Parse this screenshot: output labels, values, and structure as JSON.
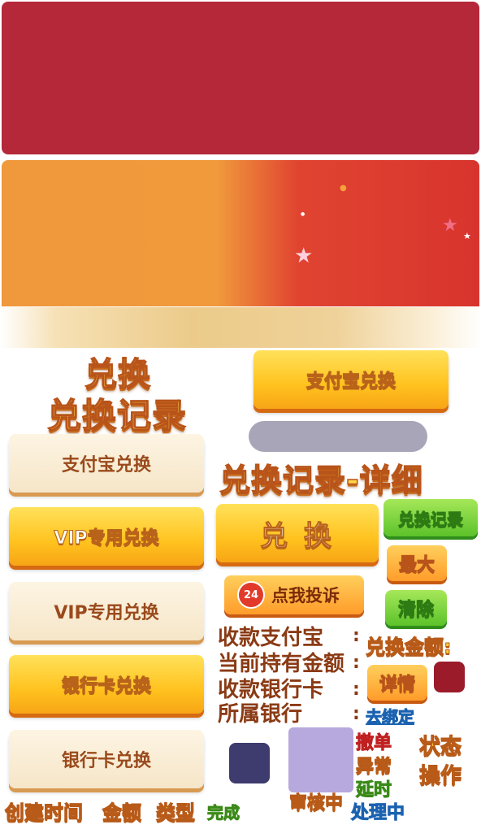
{
  "titles": {
    "exchange": "兑换",
    "exchange_records": "兑换记录",
    "records_detail": "兑换记录-详细"
  },
  "buttons": {
    "alipay_exchange_gold": "支付宝兑换",
    "alipay_exchange_cream": "支付宝兑换",
    "vip_exchange_gold": "VIP专用兑换",
    "vip_exchange_cream": "VIP专用兑换",
    "bank_exchange_gold": "银行卡兑换",
    "bank_exchange_cream": "银行卡兑换",
    "exchange_big": "兑 换",
    "exchange_records": "兑换记录",
    "max": "最大",
    "clear": "清除",
    "complaint": "点我投诉",
    "complaint_badge": "24",
    "details": "详情"
  },
  "form": {
    "alipay_account": "收款支付宝",
    "current_balance": "当前持有金额",
    "bank_card": "收款银行卡",
    "bank_name": "所属银行",
    "colon": ":",
    "exchange_amount": "兑换金额:",
    "bind_link": "去绑定"
  },
  "table_headers": {
    "created_time": "创建时间",
    "amount": "金额",
    "type": "类型"
  },
  "status_labels": {
    "done": "完成",
    "reviewing": "审核中",
    "cancel": "撤单",
    "abnormal": "异常",
    "delayed": "延时",
    "processing": "处理中",
    "status": "状态",
    "action": "操作"
  },
  "colors": {
    "panel_red": "#b5283a",
    "swatch_dark_red": "#9b1b2b",
    "swatch_navy": "#3e3b6e",
    "swatch_lavender": "#b7a8dd",
    "input_gray": "#a9a5b8"
  },
  "icons": {
    "star": "star-icon",
    "phone": "phone-24-icon"
  }
}
